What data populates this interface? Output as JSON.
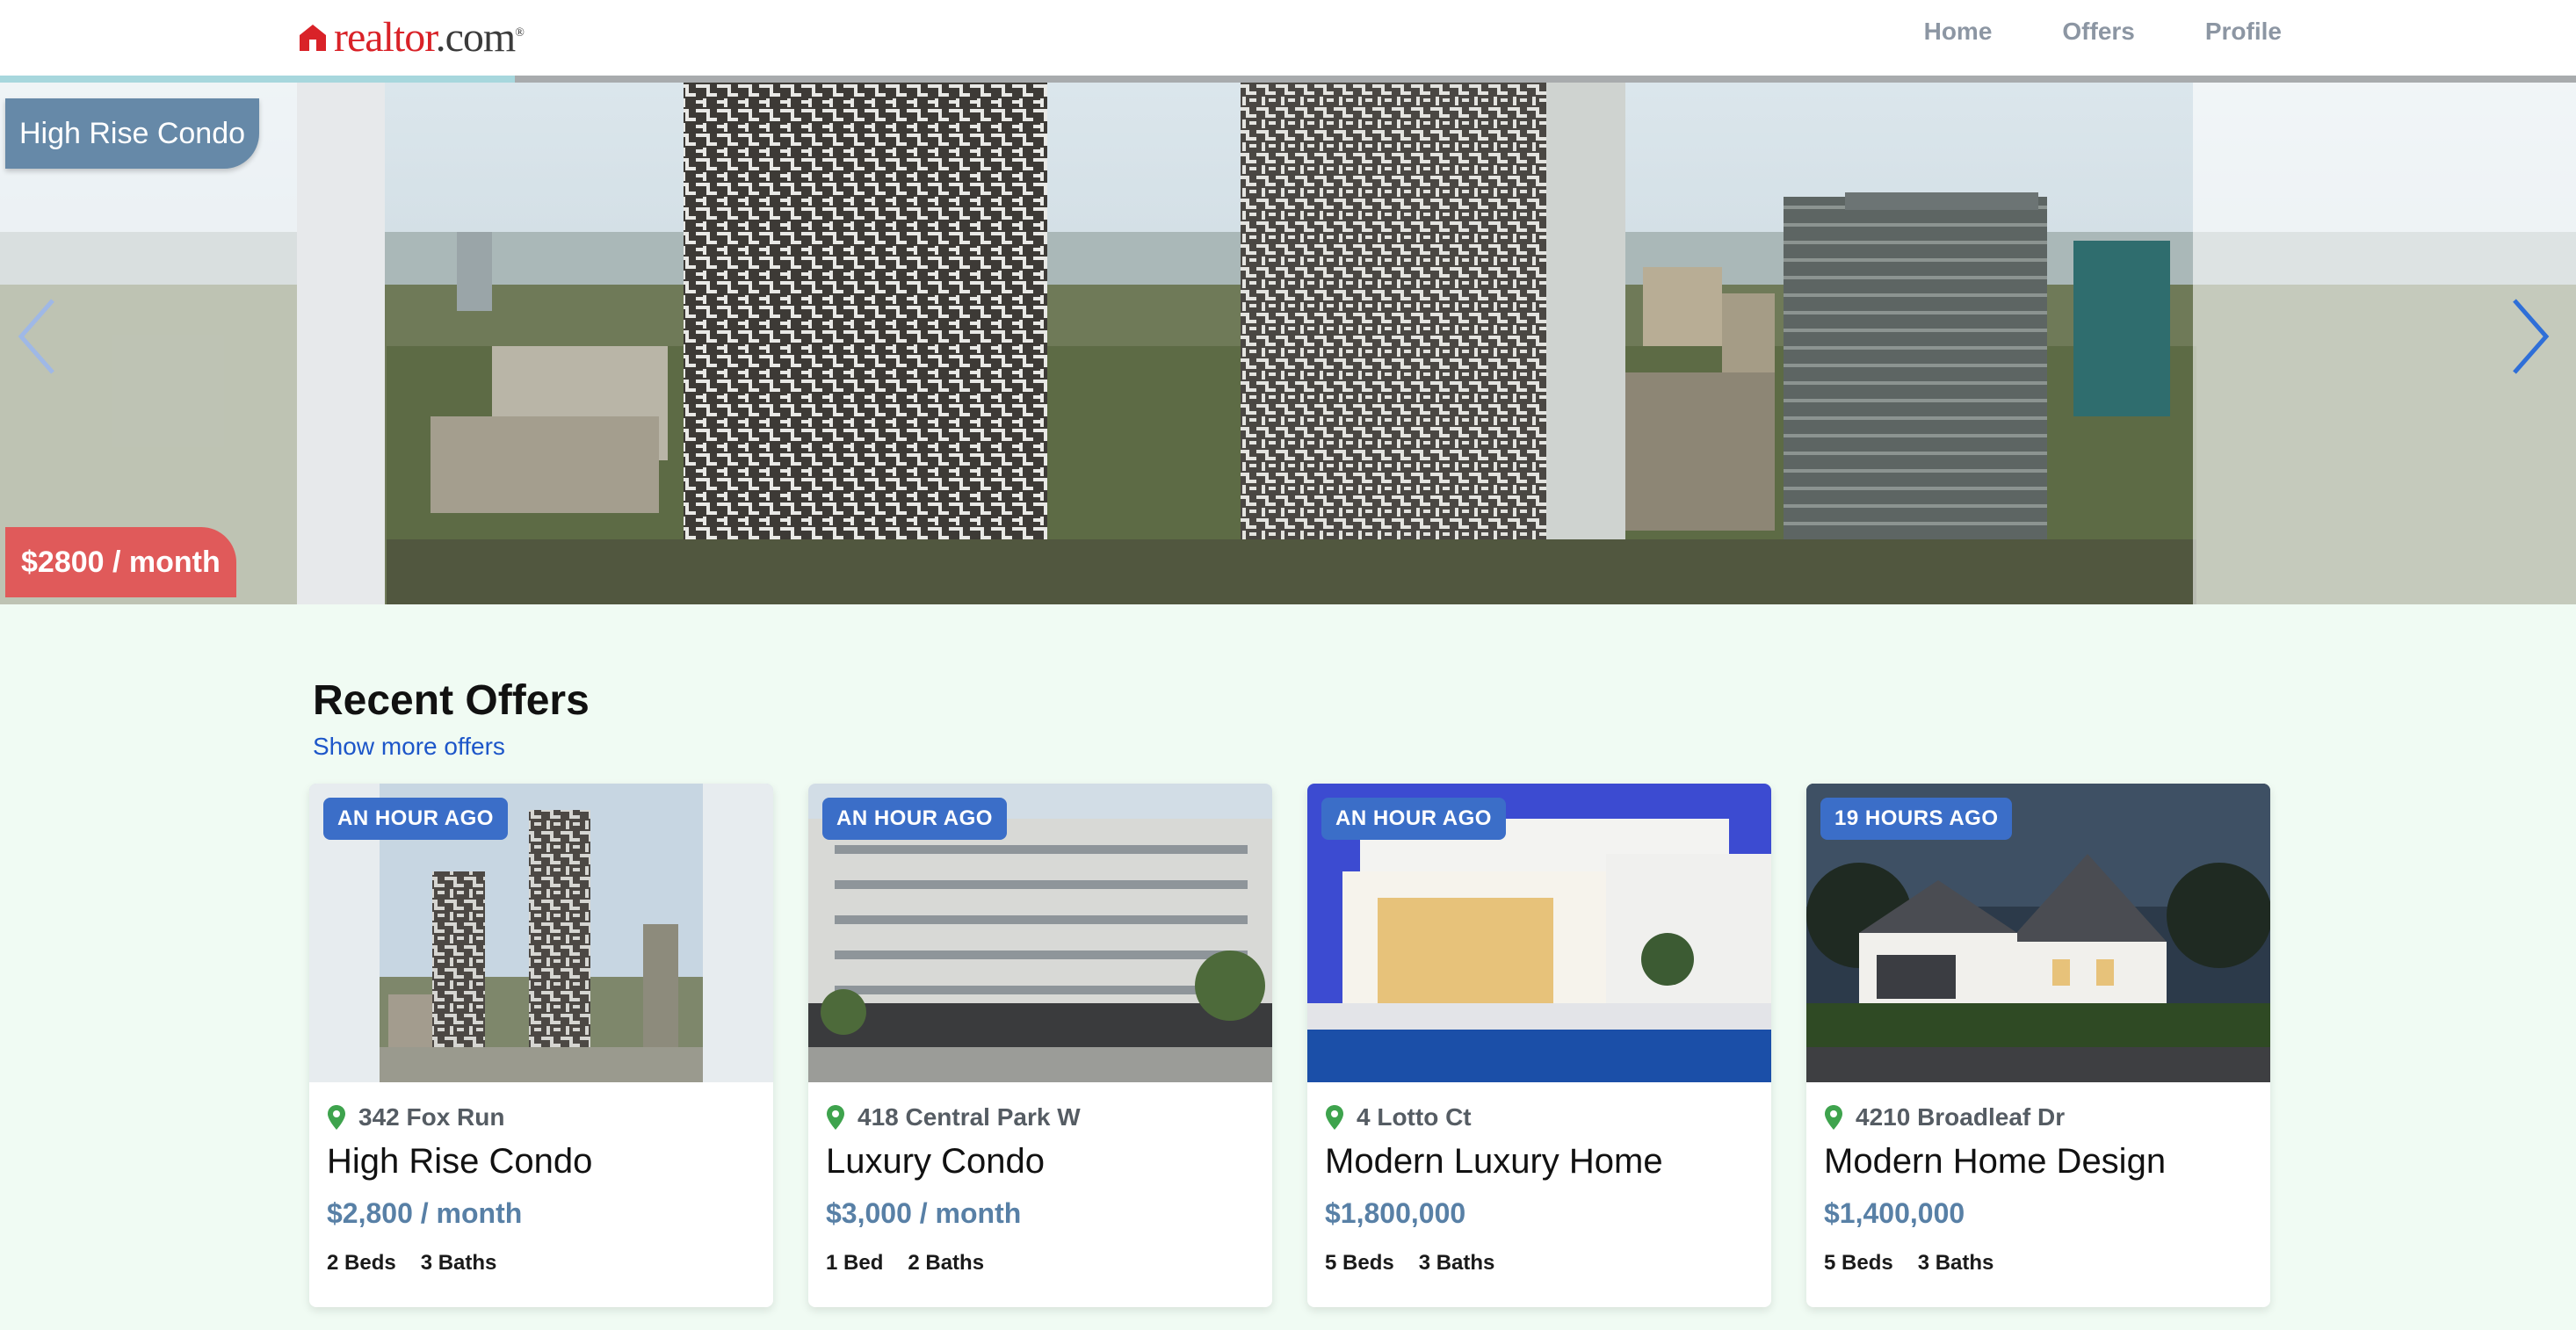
{
  "header": {
    "logo": {
      "text_main": "realtor",
      "text_dot": ".com",
      "icon": "house-icon",
      "brand_color": "#d92228"
    },
    "nav": [
      {
        "label": "Home"
      },
      {
        "label": "Offers"
      },
      {
        "label": "Profile"
      }
    ],
    "nav_color": "#8c96a3"
  },
  "carousel": {
    "progress_fraction": 0.2,
    "slide": {
      "title": "High Rise Condo",
      "price": "$2800 / month"
    },
    "prev_icon": "chevron-left-icon",
    "next_icon": "chevron-right-icon",
    "title_tag_color": "#6689a8",
    "price_tag_color": "#e05a5a"
  },
  "recent": {
    "title": "Recent Offers",
    "show_more": "Show more offers",
    "badge_color": "#3b6ec8",
    "price_color": "#5880a6",
    "cards": [
      {
        "badge": "AN HOUR AGO",
        "address": "342 Fox Run",
        "title": "High Rise Condo",
        "price": "$2,800 / month",
        "beds": "2 Beds",
        "baths": "3 Baths"
      },
      {
        "badge": "AN HOUR AGO",
        "address": "418 Central Park W",
        "title": "Luxury Condo",
        "price": "$3,000 / month",
        "beds": "1 Bed",
        "baths": "2 Baths"
      },
      {
        "badge": "AN HOUR AGO",
        "address": "4 Lotto Ct",
        "title": "Modern Luxury Home",
        "price": "$1,800,000",
        "beds": "5 Beds",
        "baths": "3 Baths"
      },
      {
        "badge": "19 HOURS AGO",
        "address": "4210 Broadleaf Dr",
        "title": "Modern Home Design",
        "price": "$1,400,000",
        "beds": "5 Beds",
        "baths": "3 Baths"
      }
    ]
  }
}
